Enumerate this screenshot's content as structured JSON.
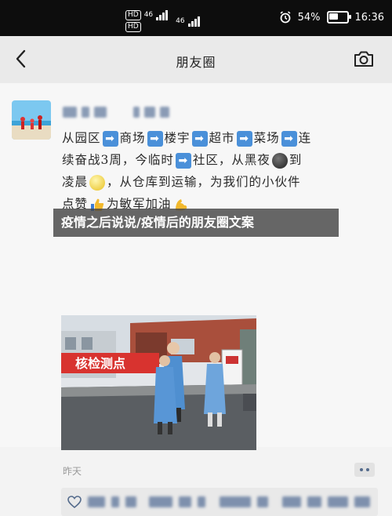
{
  "status_bar": {
    "hd1": "HD",
    "net1": "46",
    "hd2": "HD",
    "net2": "46",
    "battery_percent": "54%",
    "battery_level": 0.54,
    "time": "16:36",
    "icons": [
      "alarm-icon",
      "battery-icon",
      "signal-icon"
    ]
  },
  "nav": {
    "title": "朋友圈",
    "back_icon": "chevron-left-icon",
    "camera_icon": "camera-icon"
  },
  "post": {
    "line1": [
      "从园区",
      "商场",
      "楼宇",
      "超市",
      "菜场",
      "连"
    ],
    "line2a": "续奋战3周，今临时",
    "line2b": "社区，从黑夜",
    "line2c": "到",
    "line3a": "凌晨",
    "line3b": "，从仓库到运输，为我们的小伙件",
    "line4a": "点赞",
    "line4b": "为敏军加油",
    "photo_sign": "核检测点",
    "time": "昨天"
  },
  "banner": {
    "text": "疫情之后说说/疫情后的朋友圈文案"
  },
  "colors": {
    "status_bg": "#0d0d0d",
    "nav_bg": "#eaeaea",
    "banner_bg": "#464646",
    "link_blue": "#546b8c",
    "arrow_blue": "#4a90d9"
  }
}
